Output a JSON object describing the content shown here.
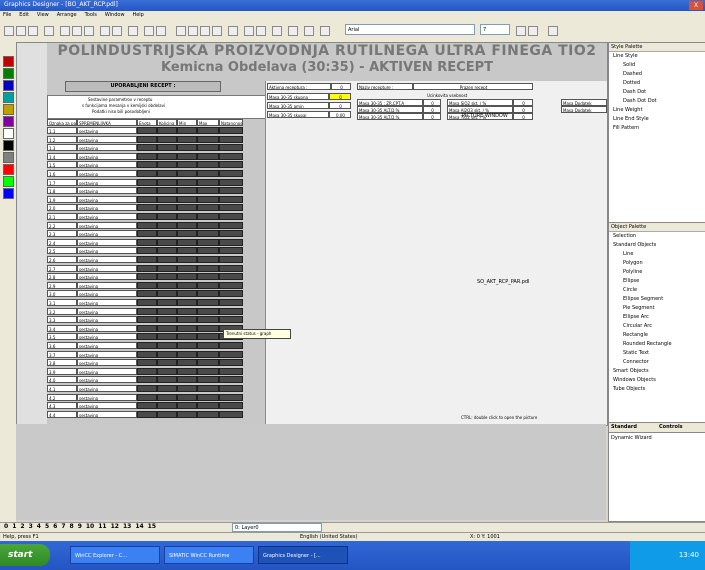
{
  "window": {
    "title": "Graphics Designer - [BO_AKT_RCP.pdl]",
    "close": "X"
  },
  "menu": [
    "File",
    "Edit",
    "View",
    "Arrange",
    "Tools",
    "Window",
    "Help"
  ],
  "toolbar": {
    "font_name": "Arial",
    "font_size": "7"
  },
  "palette_colors": [
    "#c00000",
    "#008000",
    "#0000c0",
    "#00a0a0",
    "#c0a000",
    "#8000a0",
    "#ffffff",
    "#000000",
    "#808080",
    "#ff0000",
    "#00ff00",
    "#0000ff"
  ],
  "header": {
    "title1": "POLINDUSTRIJSKA PROIZVODNJA RUTILNEGA ULTRA FINEGA TIO2",
    "title2": "Kemicna Obdelava (30:35) - AKTIVEN RECEPT"
  },
  "recipe": {
    "used_label": "UPORABLJENI RECEPT :",
    "active_label": "Aktivna receptura :",
    "active_value": "0",
    "name_label": "Naziv recepture :",
    "name_value": "Prazen recept",
    "info_lines": [
      "Sestavine parametrov v receptu",
      "s funkcijama mesanja v kemijski obdelavi",
      "Podatki niso bili posodobljeni"
    ],
    "columns": [
      "Oznaka za parametre",
      "SPREMENLJIVKA",
      "Enota",
      "Kolicina",
      "Min",
      "Max",
      "Natancnost"
    ],
    "rows": [
      {
        "idx": "1.1",
        "name": "sestavina"
      },
      {
        "idx": "1.2",
        "name": "sestavina"
      },
      {
        "idx": "1.3",
        "name": "sestavina"
      },
      {
        "idx": "1.4",
        "name": "sestavina"
      },
      {
        "idx": "1.5",
        "name": "sestavina"
      },
      {
        "idx": "1.6",
        "name": "sestavina"
      },
      {
        "idx": "1.7",
        "name": "sestavina"
      },
      {
        "idx": "1.8",
        "name": "sestavina"
      },
      {
        "idx": "1.9",
        "name": "sestavina"
      },
      {
        "idx": "2.0",
        "name": "sestavina"
      },
      {
        "idx": "2.1",
        "name": "sestavina"
      },
      {
        "idx": "2.2",
        "name": "sestavina"
      },
      {
        "idx": "2.3",
        "name": "sestavina"
      },
      {
        "idx": "2.4",
        "name": "sestavina"
      },
      {
        "idx": "2.5",
        "name": "sestavina"
      },
      {
        "idx": "2.6",
        "name": "sestavina"
      },
      {
        "idx": "2.7",
        "name": "sestavina"
      },
      {
        "idx": "2.8",
        "name": "sestavina"
      },
      {
        "idx": "2.9",
        "name": "sestavina"
      },
      {
        "idx": "3.0",
        "name": "sestavina"
      },
      {
        "idx": "3.1",
        "name": "sestavina"
      },
      {
        "idx": "3.2",
        "name": "sestavina"
      },
      {
        "idx": "3.3",
        "name": "sestavina"
      },
      {
        "idx": "3.4",
        "name": "sestavina"
      },
      {
        "idx": "3.5",
        "name": "sestavina"
      },
      {
        "idx": "3.6",
        "name": "sestavina"
      },
      {
        "idx": "3.7",
        "name": "sestavina"
      },
      {
        "idx": "3.8",
        "name": "sestavina"
      },
      {
        "idx": "3.9",
        "name": "sestavina"
      },
      {
        "idx": "4.0",
        "name": "sestavina"
      },
      {
        "idx": "4.1",
        "name": "sestavina"
      },
      {
        "idx": "4.2",
        "name": "sestavina"
      },
      {
        "idx": "4.3",
        "name": "sestavina"
      },
      {
        "idx": "4.4",
        "name": "sestavina"
      }
    ]
  },
  "params": {
    "rows": [
      {
        "label": "Masa 30-35 skupna",
        "value": "0"
      },
      {
        "label": "Masa 30-35 amin",
        "value": "0"
      },
      {
        "label": "Masa 30-35 skupaj",
        "value": "0.00"
      }
    ],
    "mid_header": "Ucinkovita vsebnost",
    "mid_rows": [
      {
        "label": "Masa 30-35 : ZR.CPT.A",
        "value": "0"
      },
      {
        "label": "Masa 30-35 ALT.D.%",
        "value": "0"
      },
      {
        "label": "Masa 30-35 ALT.D.%",
        "value": "0"
      }
    ],
    "right_rows": [
      {
        "label": "Masa SiO2 skt. / %",
        "value": "0"
      },
      {
        "label": "Masa Al2O3 skt. / %",
        "value": "0"
      },
      {
        "label": "Masa TiO2 skt. / %",
        "value": "0"
      }
    ],
    "far_rows": [
      "Masa Dodatek",
      "Masa Dodatek"
    ]
  },
  "picture_window": "PICTURE WINDOW",
  "picture_file": "SO_AKT_RCP_PAR.pdl",
  "tooltip": "Trenutni status - graph",
  "hint": "CTRL: double click to open the picture",
  "pages": [
    "0",
    "1",
    "2",
    "3",
    "4",
    "5",
    "6",
    "7",
    "8",
    "9",
    "10",
    "11",
    "12",
    "13",
    "14",
    "15"
  ],
  "layers_dropdown": "0: Layer0",
  "right_panels": {
    "style_title": "Style Palette",
    "style_items": [
      "Line Style",
      "Solid",
      "Dashed",
      "Dotted",
      "Dash Dot",
      "Dash Dot Dot",
      "Line Weight",
      "Line End Style",
      "Fill Pattern"
    ],
    "object_title": "Object Palette",
    "object_items": [
      "Selection",
      "Standard Objects",
      "Line",
      "Polygon",
      "Polyline",
      "Ellipse",
      "Circle",
      "Ellipse Segment",
      "Pie Segment",
      "Ellipse Arc",
      "Circular Arc",
      "Rectangle",
      "Rounded Rectangle",
      "Static Text",
      "Connector",
      "Smart Objects",
      "Windows Objects",
      "Tube Objects"
    ],
    "tab_standard": "Standard",
    "tab_controls": "Controls",
    "dynamic_wizard": "Dynamic Wizard"
  },
  "status": {
    "help": "Help, press F1",
    "lang": "English (United States)",
    "coords": "X: 0 Y: 1001"
  },
  "taskbar": {
    "start": "start",
    "items": [
      "WinCC Explorer - C...",
      "SIMATIC WinCC Runtime",
      "Graphics Designer - [..."
    ],
    "clock": "13:40"
  }
}
